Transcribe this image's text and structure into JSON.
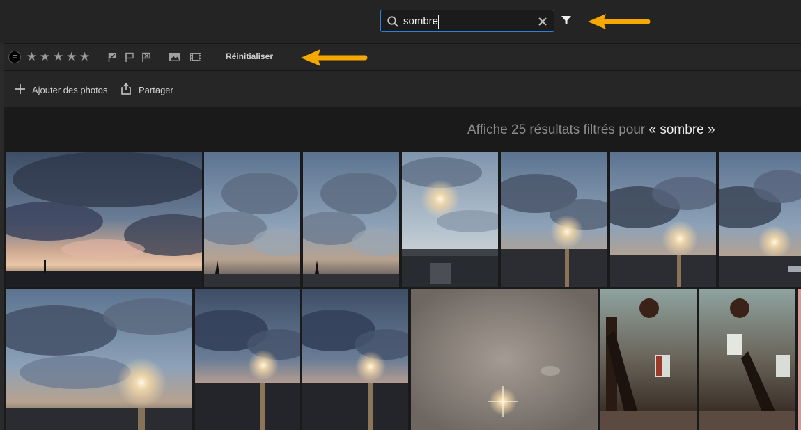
{
  "search": {
    "query": "sombre",
    "icon": "search-icon",
    "clear_icon": "close-icon"
  },
  "toolbar": {
    "filter_icon": "filter-icon"
  },
  "filters": {
    "rating_operator": "=",
    "stars": [
      "★",
      "★",
      "★",
      "★",
      "★"
    ],
    "flag_icons": [
      "flag-picked-icon",
      "flag-unflagged-icon",
      "flag-rejected-icon"
    ],
    "media_icons": [
      "photo-icon",
      "video-icon"
    ],
    "reset_label": "Réinitialiser"
  },
  "actions": {
    "add_label": "Ajouter des photos",
    "share_label": "Partager"
  },
  "results": {
    "prefix": "Affiche 25 résultats filtrés pour",
    "term": "« sombre »"
  },
  "colors": {
    "accent_blue": "#2f7fe0",
    "arrow_orange": "#f7a800",
    "background": "#1e1e1e"
  },
  "photos": [
    {
      "kind": "sunset-wide"
    },
    {
      "kind": "sailboat"
    },
    {
      "kind": "sailboat"
    },
    {
      "kind": "sun-rocks"
    },
    {
      "kind": "sun-rays"
    },
    {
      "kind": "sun-rays"
    },
    {
      "kind": "sun-rays"
    },
    {
      "kind": "sun-rays-wide"
    },
    {
      "kind": "sun-rays"
    },
    {
      "kind": "sun-rays"
    },
    {
      "kind": "flare"
    },
    {
      "kind": "lighthouse-interior"
    },
    {
      "kind": "lighthouse-interior"
    }
  ]
}
